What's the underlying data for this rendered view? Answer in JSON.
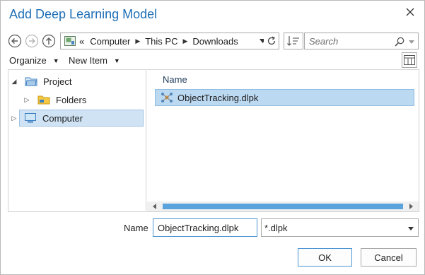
{
  "dialog": {
    "title": "Add Deep Learning Model"
  },
  "navigation": {
    "breadcrumb_prefix": "«",
    "breadcrumbs": [
      "Computer",
      "This PC",
      "Downloads"
    ],
    "search_placeholder": "Search"
  },
  "toolbar": {
    "organize_label": "Organize",
    "new_item_label": "New Item"
  },
  "tree": {
    "items": [
      {
        "label": "Project",
        "expanded": true
      },
      {
        "label": "Folders",
        "expanded": false
      },
      {
        "label": "Computer",
        "expanded": false,
        "selected": true
      }
    ]
  },
  "files": {
    "column_header": "Name",
    "items": [
      {
        "name": "ObjectTracking.dlpk",
        "selected": true
      }
    ]
  },
  "footer": {
    "name_label": "Name",
    "name_value": "ObjectTracking.dlpk",
    "filter_value": "*.dlpk",
    "ok_label": "OK",
    "cancel_label": "Cancel"
  },
  "icons": {
    "back": "back-arrow-icon",
    "forward": "forward-arrow-icon",
    "up": "up-arrow-icon",
    "refresh": "refresh-icon",
    "search": "search-icon",
    "close": "close-icon",
    "project": "project-folder-icon",
    "folders": "folder-icon",
    "computer": "computer-icon",
    "model": "deep-learning-model-icon"
  },
  "colors": {
    "title": "#1f6fb6",
    "selection": "#bcd9f2",
    "scroll_thumb": "#5aa3dc"
  }
}
